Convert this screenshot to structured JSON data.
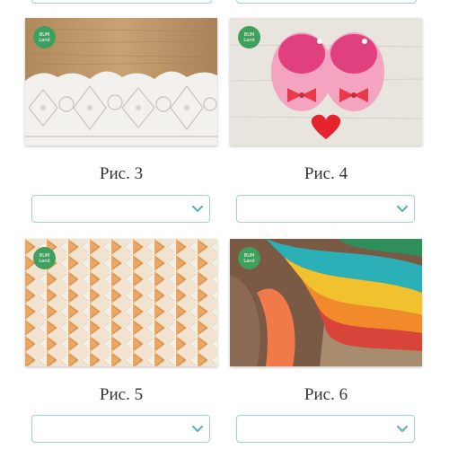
{
  "badge": {
    "line1": "BUM",
    "line2": "Land"
  },
  "cards": [
    {
      "caption": "Рис. 3",
      "image": "white-lace-doily-on-wood",
      "select_value": ""
    },
    {
      "caption": "Рис. 4",
      "image": "pink-crochet-baby-booties-with-heart",
      "select_value": ""
    },
    {
      "caption": "Рис. 5",
      "image": "orange-white-knit-texture",
      "select_value": ""
    },
    {
      "caption": "Рис. 6",
      "image": "colorful-knitted-scarves",
      "select_value": ""
    }
  ],
  "icons": {
    "dropdown": "chevron-down-icon"
  },
  "colors": {
    "select_border": "#9fd3d1",
    "chevron": "#5fb3b0",
    "badge": "#3f9f5d",
    "caption_text": "#333333"
  }
}
